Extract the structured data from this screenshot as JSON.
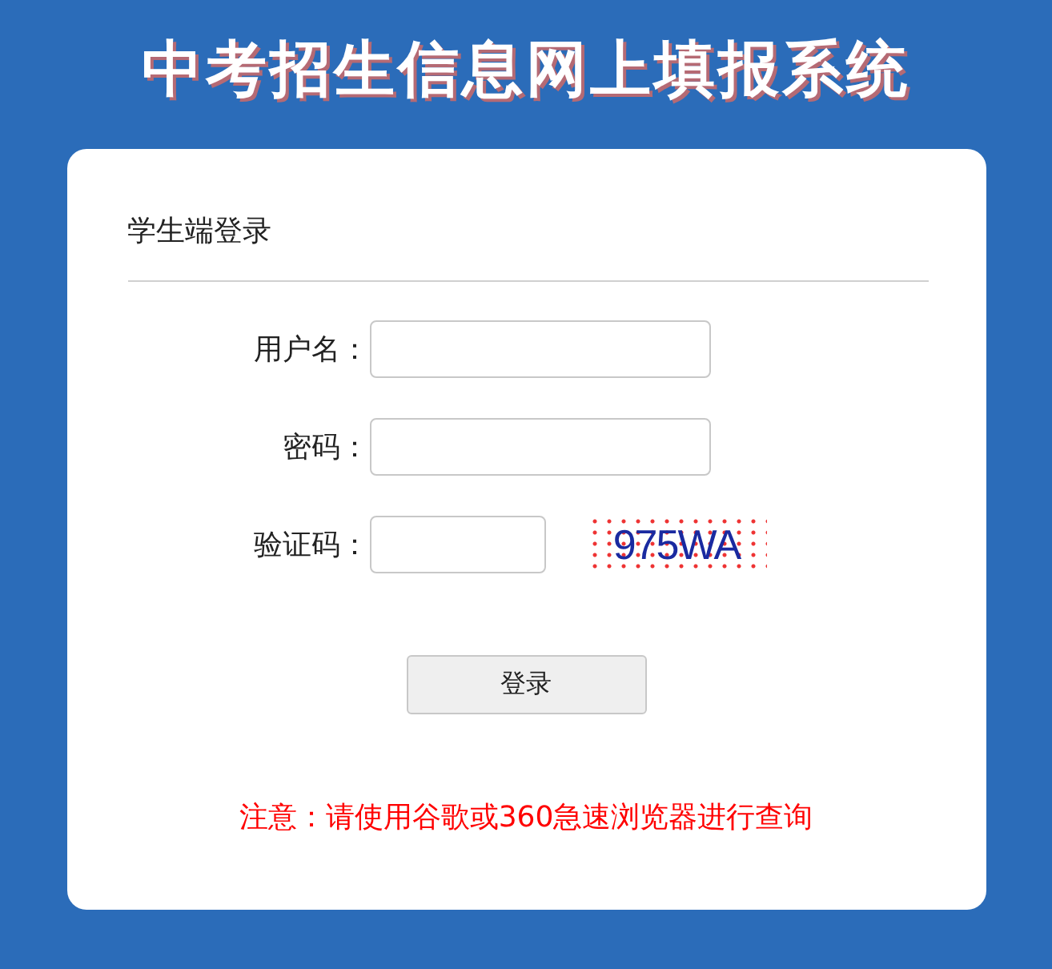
{
  "title": "中考招生信息网上填报系统",
  "login": {
    "heading": "学生端登录",
    "fields": [
      {
        "kind": "text",
        "label": "用户名："
      },
      {
        "kind": "password",
        "label": "密码："
      },
      {
        "kind": "captcha",
        "label": "验证码：",
        "captcha_text": "975WA"
      }
    ],
    "button": "登录",
    "notice": "注意：请使用谷歌或360急速浏览器进行查询"
  }
}
